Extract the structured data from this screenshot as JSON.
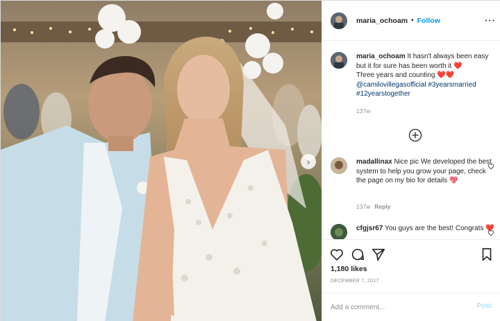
{
  "post": {
    "author": {
      "username": "maria_ochoam",
      "separator": "•",
      "follow_label": "Follow",
      "more_label": "···"
    },
    "caption": {
      "username": "maria_ochoam",
      "line1": "It hasn't always been easy but it for sure has been worth it",
      "line2": "Three years and counting",
      "mention": "@camilovillegasofficial",
      "tag1": "#3yearsmarried",
      "tag2": "#12yearstogether",
      "emoji_hearts": "❤️",
      "time": "137w"
    },
    "comments": [
      {
        "username": "madallinax",
        "text": "Nice pic We developed the best system to help you grow your page, check the page on my bio for details",
        "emoji": "💖",
        "time": "137w",
        "reply_label": "Reply"
      },
      {
        "username": "cfgjsr67",
        "text": "You guys are the best! Congrats",
        "emoji": "❤️"
      }
    ],
    "likes": "1,180 likes",
    "date": "DECEMBER 7, 2017",
    "add_comment_placeholder": "Add a comment...",
    "post_label": "Post"
  },
  "icons": {
    "carousel_next": "chevron-right-icon",
    "load_more": "plus-circle-icon",
    "like": "heart-icon",
    "comment": "comment-icon",
    "share": "paper-plane-icon",
    "save": "bookmark-icon"
  },
  "colors": {
    "link": "#0095f6",
    "mention": "#00376b",
    "muted": "#8e8e8e",
    "post_disabled": "#b2dffc"
  }
}
